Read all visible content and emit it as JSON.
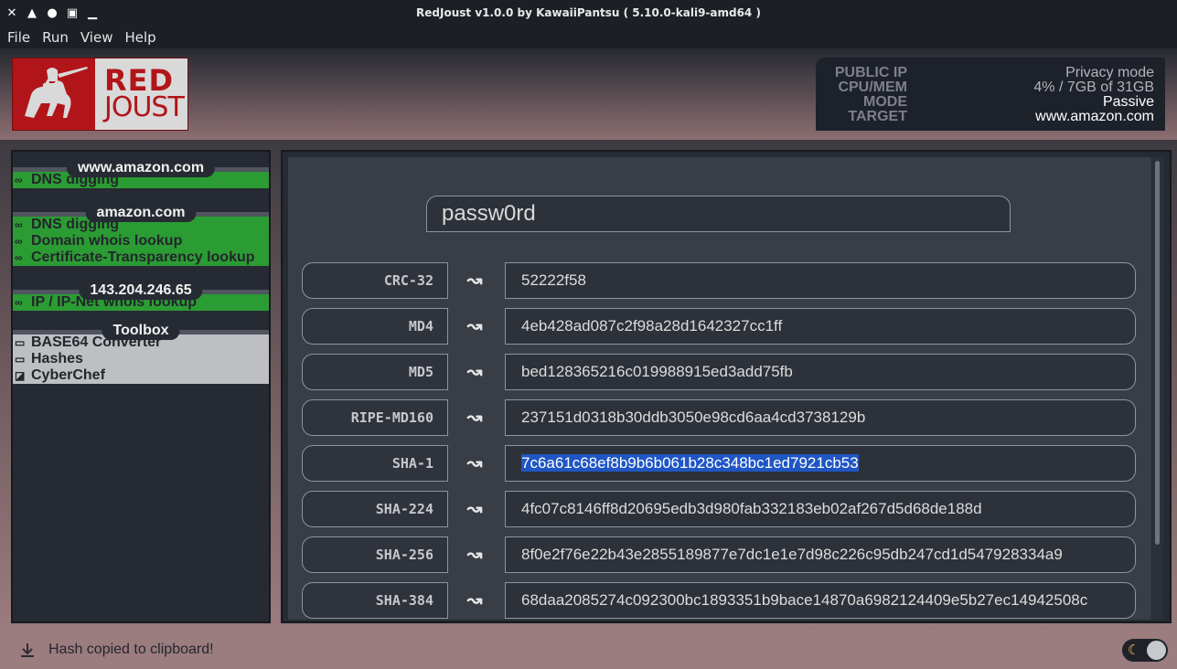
{
  "window": {
    "title": "RedJoust v1.0.0 by KawaiiPantsu ( 5.10.0-kali9-amd64 )"
  },
  "menu": [
    "File",
    "Run",
    "View",
    "Help"
  ],
  "logo": {
    "line1": "RED",
    "line2": "JOUST"
  },
  "info": {
    "labels": [
      "PUBLIC IP",
      "CPU/MEM",
      "MODE",
      "TARGET"
    ],
    "public_ip": "Privacy mode",
    "cpu_mem": "4% / 7GB of 31GB",
    "mode": "Passive",
    "target": "www.amazon.com"
  },
  "sidebar": {
    "sections": [
      {
        "title": "www.amazon.com",
        "items": [
          "DNS digging"
        ]
      },
      {
        "title": "amazon.com",
        "items": [
          "DNS digging",
          "Domain whois lookup",
          "Certificate-Transparency lookup"
        ]
      },
      {
        "title": "143.204.246.65",
        "items": [
          "IP / IP-Net whois lookup"
        ]
      },
      {
        "title": "Toolbox",
        "items": [
          "BASE64 Converter",
          "Hashes",
          "CyberChef"
        ]
      }
    ]
  },
  "hash_tool": {
    "input_value": "passw0rd",
    "rows": [
      {
        "label": "CRC-32",
        "value": "52222f58"
      },
      {
        "label": "MD4",
        "value": "4eb428ad087c2f98a28d1642327cc1ff"
      },
      {
        "label": "MD5",
        "value": "bed128365216c019988915ed3add75fb"
      },
      {
        "label": "RIPE-MD160",
        "value": "237151d0318b30ddb3050e98cd6aa4cd3738129b"
      },
      {
        "label": "SHA-1",
        "value": "7c6a61c68ef8b9b6b061b28c348bc1ed7921cb53"
      },
      {
        "label": "SHA-224",
        "value": "4fc07c8146ff8d20695edb3d980fab332183eb02af267d5d68de188d"
      },
      {
        "label": "SHA-256",
        "value": "8f0e2f76e22b43e2855189877e7dc1e1e7d98c226c95db247cd1d547928334a9"
      },
      {
        "label": "SHA-384",
        "value": "68daa2085274c092300bc1893351b9bace14870a6982124409e5b27ec14942508c"
      }
    ]
  },
  "status": {
    "message": "Hash copied to clipboard!"
  },
  "icons": {
    "wm": [
      "close-icon",
      "maximize-icon",
      "dot-icon",
      "restore-icon",
      "minimize-icon"
    ],
    "recon_item": "binoculars-icon",
    "tool_item": "window-icon",
    "cyberchef": "external-app-icon",
    "copy_arrow": "wave-arrow-icon",
    "status": "download-icon",
    "theme": "moon-icon"
  }
}
